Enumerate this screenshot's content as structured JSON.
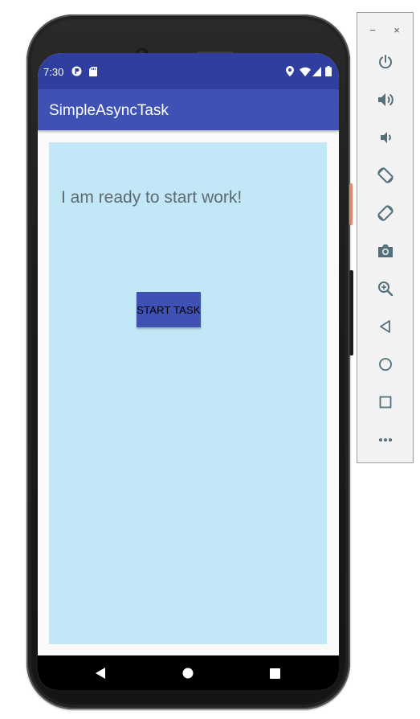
{
  "status_bar": {
    "time": "7:30",
    "icons": [
      "data-saver-icon",
      "sd-card-icon",
      "location-icon",
      "wifi-icon",
      "signal-icon",
      "battery-icon"
    ]
  },
  "app_bar": {
    "title": "SimpleAsyncTask"
  },
  "main": {
    "message": "I am ready to start work!",
    "start_button_label": "START TASK"
  },
  "nav_bar": {
    "buttons": [
      "back-icon",
      "home-icon",
      "recents-icon"
    ]
  },
  "emulator_panel": {
    "window_controls": {
      "minimize": "−",
      "close": "×"
    },
    "tools": [
      "power-icon",
      "volume-up-icon",
      "volume-down-icon",
      "rotate-left-icon",
      "rotate-right-icon",
      "camera-icon",
      "zoom-icon",
      "back-icon",
      "home-icon",
      "overview-icon",
      "more-icon"
    ]
  },
  "colors": {
    "status_bar": "#303f9f",
    "app_bar": "#3f51b5",
    "content_background": "#c2e8f8",
    "button": "#3f51b5",
    "message_text": "#5f6a70"
  }
}
